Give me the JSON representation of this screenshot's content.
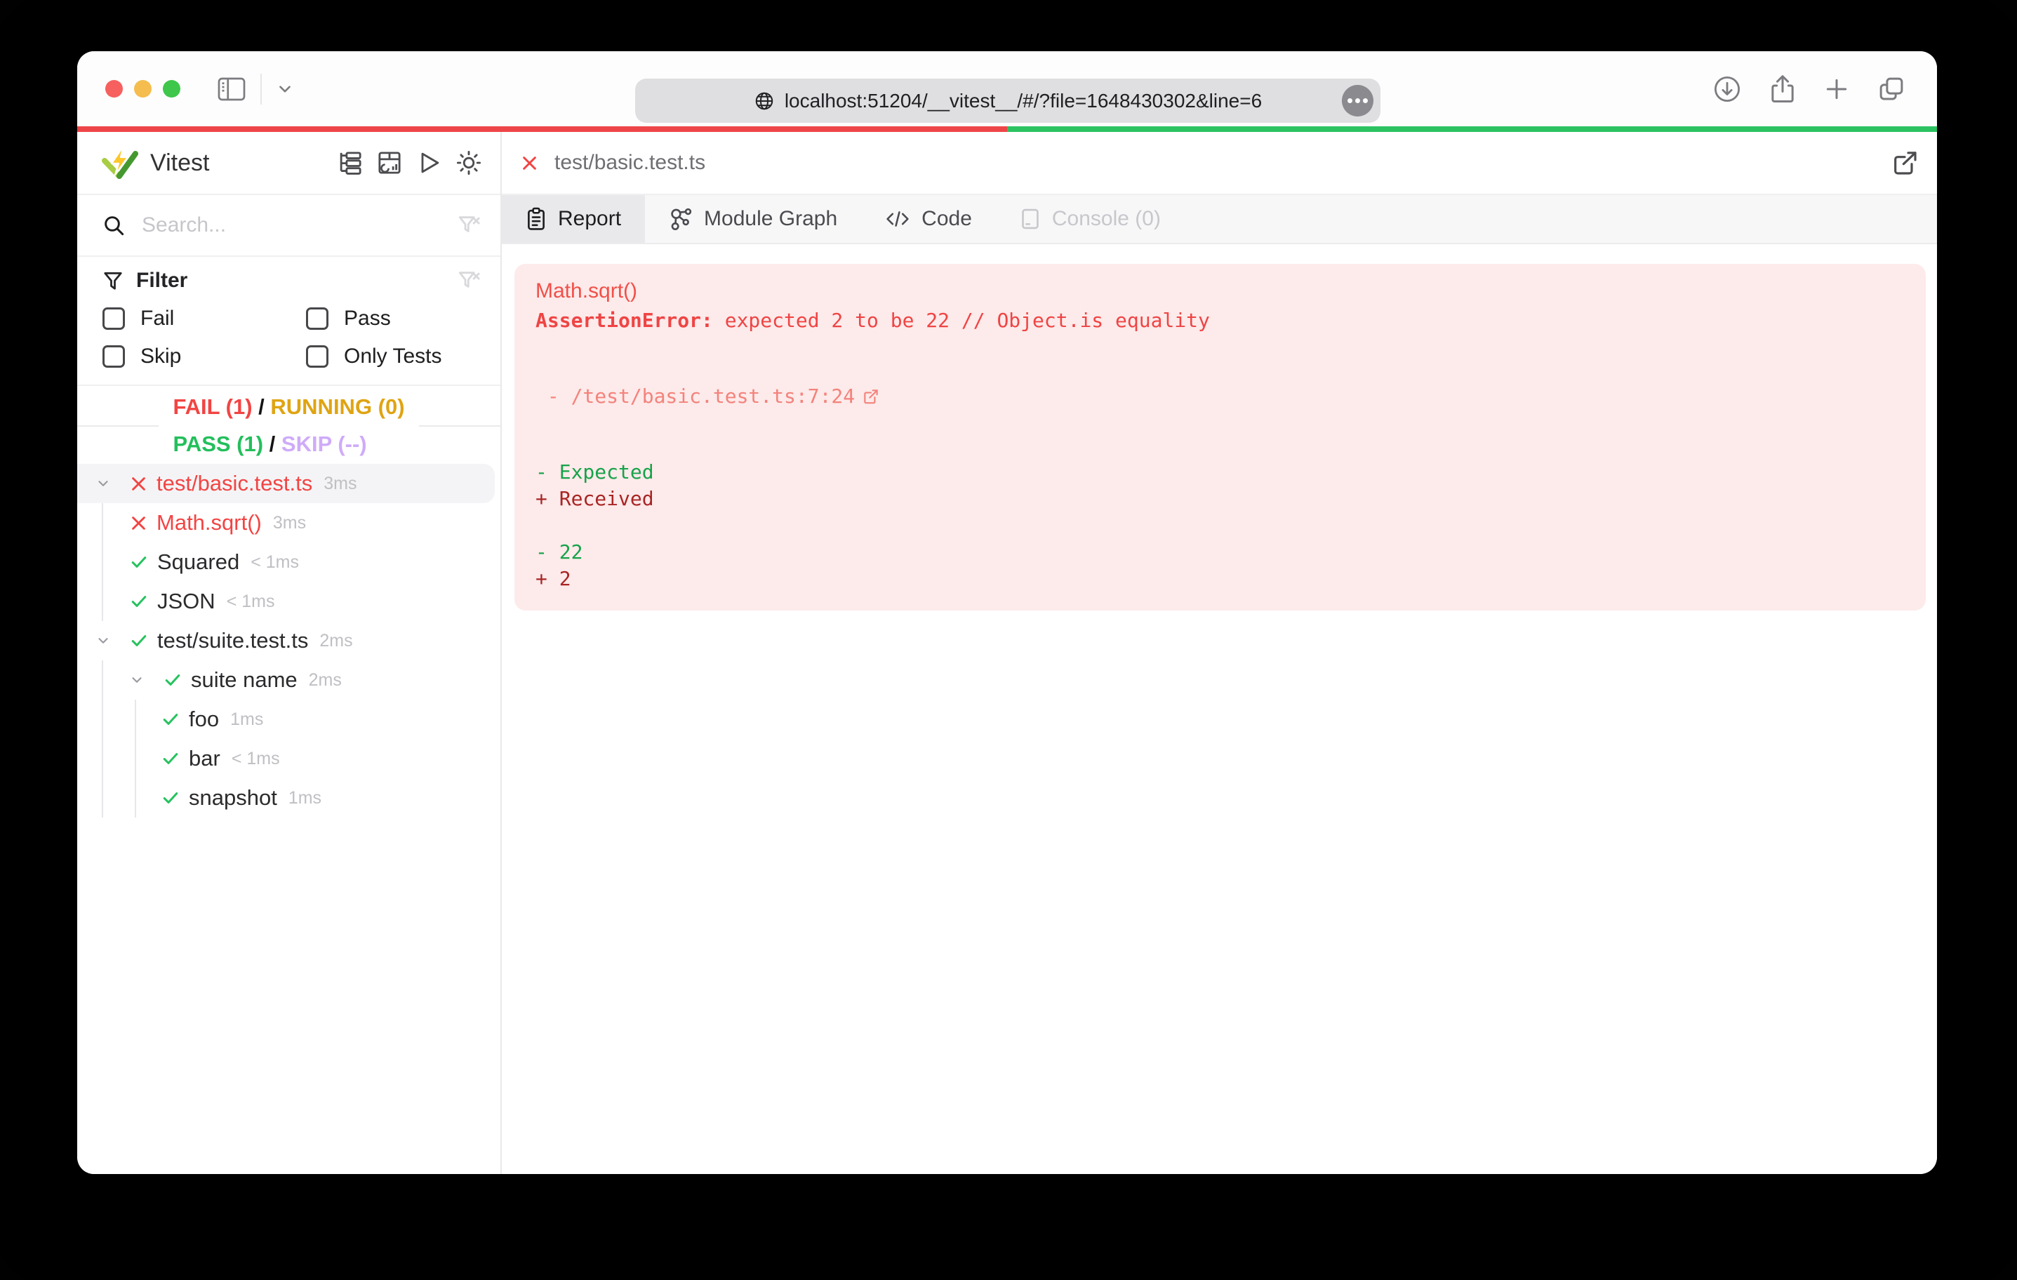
{
  "browser": {
    "url": "localhost:51204/__vitest__/#/?file=1648430302&line=6",
    "traffic_lights": {
      "close": "#f6605f",
      "minimize": "#f5bd4e",
      "zoom": "#3ec74b"
    }
  },
  "progress": {
    "fail_color": "#ee4548",
    "pass_color": "#2cc261",
    "fail_pct": 50,
    "pass_pct": 50
  },
  "sidebar": {
    "app_title": "Vitest",
    "search_placeholder": "Search...",
    "filter": {
      "title": "Filter",
      "options": [
        {
          "label": "Fail"
        },
        {
          "label": "Pass"
        },
        {
          "label": "Skip"
        },
        {
          "label": "Only Tests"
        }
      ]
    },
    "status": {
      "fail_label": "FAIL (1)",
      "running_label": "RUNNING (0)",
      "pass_label": "PASS (1)",
      "skip_label": "SKIP (--)",
      "separator": " / "
    },
    "tree": {
      "rows": [
        {
          "label": "test/basic.test.ts",
          "time": "3ms",
          "state": "fail"
        },
        {
          "label": "Math.sqrt()",
          "time": "3ms",
          "state": "fail"
        },
        {
          "label": "Squared",
          "time": "< 1ms",
          "state": "pass"
        },
        {
          "label": "JSON",
          "time": "< 1ms",
          "state": "pass"
        },
        {
          "label": "test/suite.test.ts",
          "time": "2ms",
          "state": "pass"
        },
        {
          "label": "suite name",
          "time": "2ms",
          "state": "pass"
        },
        {
          "label": "foo",
          "time": "1ms",
          "state": "pass"
        },
        {
          "label": "bar",
          "time": "< 1ms",
          "state": "pass"
        },
        {
          "label": "snapshot",
          "time": "1ms",
          "state": "pass"
        }
      ]
    }
  },
  "main": {
    "file_title": "test/basic.test.ts",
    "tabs": [
      {
        "label": "Report",
        "active": true
      },
      {
        "label": "Module Graph"
      },
      {
        "label": "Code"
      },
      {
        "label": "Console (0)",
        "disabled": true
      }
    ],
    "report": {
      "test_name": "Math.sqrt()",
      "error_name": "AssertionError: ",
      "error_message": "expected 2 to be 22 // Object.is equality",
      "stack_line": " - /test/basic.test.ts:7:24",
      "diff_expected_label": "- Expected",
      "diff_received_label": "+ Received",
      "diff_expected_value": "- 22",
      "diff_received_value": "+ 2"
    }
  }
}
